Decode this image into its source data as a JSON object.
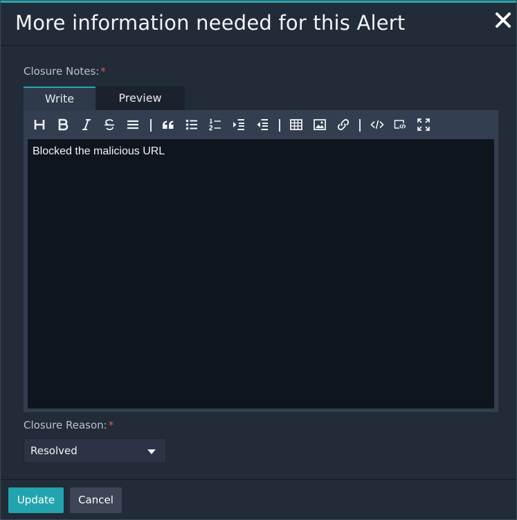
{
  "modal": {
    "title": "More information needed for this Alert",
    "close_label": "×"
  },
  "closure_notes": {
    "label": "Closure Notes:",
    "required_mark": "*",
    "tabs": [
      {
        "label": "Write",
        "active": true
      },
      {
        "label": "Preview",
        "active": false
      }
    ],
    "toolbar": [
      "heading-icon",
      "bold-icon",
      "italic-icon",
      "strikethrough-icon",
      "horizontal-rule-icon",
      "quote-icon",
      "unordered-list-icon",
      "ordered-list-icon",
      "indent-icon",
      "outdent-icon",
      "table-icon",
      "image-icon",
      "link-icon",
      "code-icon",
      "code-block-icon",
      "fullscreen-icon"
    ],
    "text": "Blocked the malicious URL"
  },
  "closure_reason": {
    "label": "Closure Reason:",
    "required_mark": "*",
    "selected": "Resolved"
  },
  "footer": {
    "update_label": "Update",
    "cancel_label": "Cancel"
  },
  "colors": {
    "accent": "#26a9b3",
    "required": "#e05555",
    "background": "#222b38",
    "editor_background": "#0f151d"
  }
}
